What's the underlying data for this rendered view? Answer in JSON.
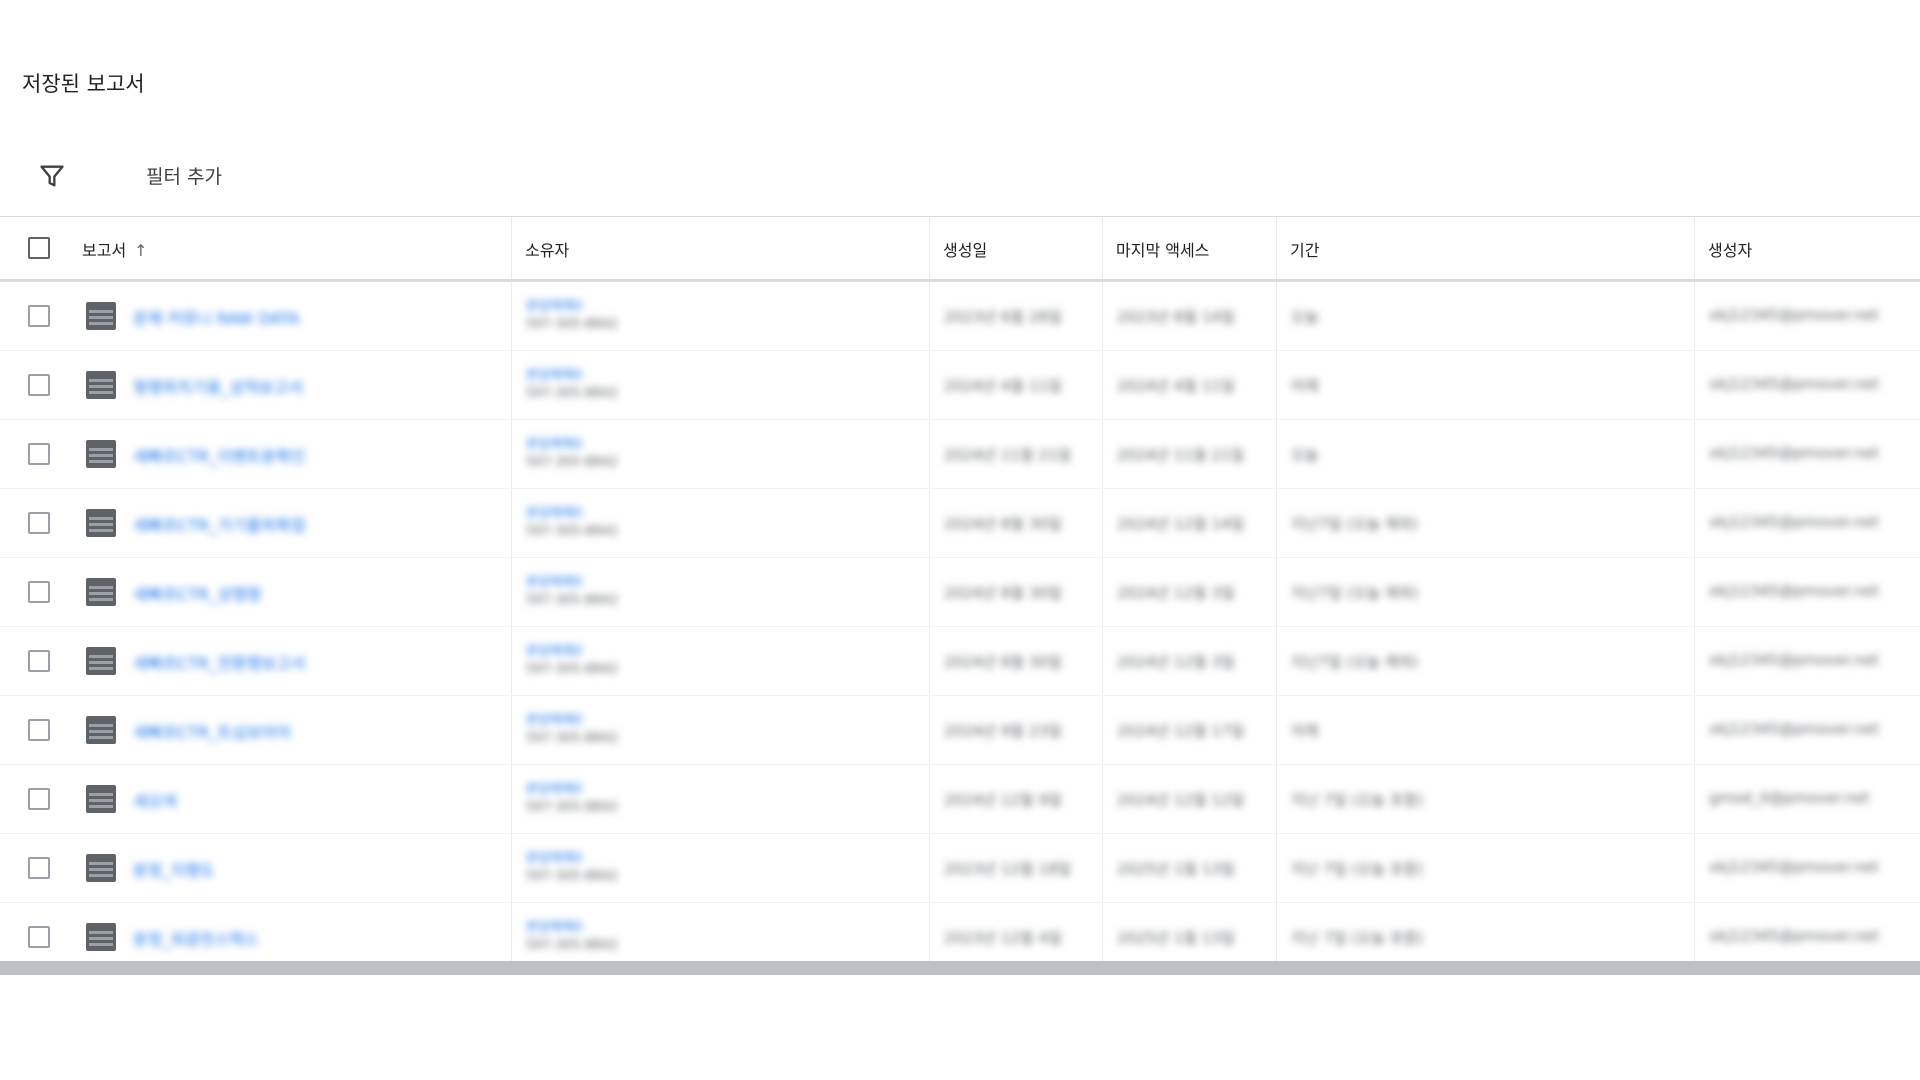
{
  "page": {
    "title": "저장된 보고서"
  },
  "filter": {
    "label": "필터 추가"
  },
  "table": {
    "columns": {
      "report": "보고서",
      "owner": "소유자",
      "created": "생성일",
      "last_access": "마지막 액세스",
      "period": "기간",
      "creator": "생성자"
    },
    "sort_indicator": "↑",
    "rows": [
      {
        "name": "문제 커뮤니 RAW DATA",
        "owner_name": "본담매체0",
        "owner_id": "597-305-8842",
        "created": "2023년 6월 28일",
        "last_access": "2023년 8월 14일",
        "period": "오늘",
        "creator": "xkj12345@pmover.net"
      },
      {
        "name": "형행위치기용_성적보고서",
        "owner_name": "본담매체0",
        "owner_id": "597-305-8842",
        "created": "2024년 4월 11일",
        "last_access": "2024년 4월 11일",
        "period": "어제",
        "creator": "xkj12345@pmover.net"
      },
      {
        "name": "세빠르CTR_이벤트분확인",
        "owner_name": "본담매체0",
        "owner_id": "597-305-8842",
        "created": "2024년 11월 21일",
        "last_access": "2024년 11월 21일",
        "period": "오늘",
        "creator": "xkj12345@pmover.net"
      },
      {
        "name": "세빠르CTR_가기물위확점",
        "owner_name": "본담매체0",
        "owner_id": "597-305-8842",
        "created": "2024년 8월 30일",
        "last_access": "2024년 12월 14일",
        "period": "지난7일 (오늘 제외)",
        "creator": "xkj12345@pmover.net"
      },
      {
        "name": "세빠르CTR_성행형",
        "owner_name": "본담매체0",
        "owner_id": "597-305-8842",
        "created": "2024년 8월 30일",
        "last_access": "2024년 12월 3일",
        "period": "지난7일 (오늘 제외)",
        "creator": "xkj12345@pmover.net"
      },
      {
        "name": "세빠르CTR_전환행보고서",
        "owner_name": "본담매체0",
        "owner_id": "597-305-8842",
        "created": "2024년 8월 30일",
        "last_access": "2024년 12월 3일",
        "period": "지난7일 (오늘 제외)",
        "creator": "xkj12345@pmover.net"
      },
      {
        "name": "세빠르CTR_트심보어어",
        "owner_name": "본담매체0",
        "owner_id": "597-305-8842",
        "created": "2024년 9월 23일",
        "last_access": "2024년 12월 17일",
        "period": "어제",
        "creator": "xkj12345@pmover.net"
      },
      {
        "name": "세오여",
        "owner_name": "본담매체0",
        "owner_id": "597-305-8842",
        "created": "2024년 12월 9일",
        "last_access": "2024년 12월 12일",
        "period": "지난 7일 (오늘 포함)",
        "creator": "gmod_0@pmover.net"
      },
      {
        "name": "분정_지행도",
        "owner_name": "본담매체0",
        "owner_id": "597-305-8842",
        "created": "2023년 12월 18일",
        "last_access": "2025년 1월 13일",
        "period": "지난 7일 (오늘 포함)",
        "creator": "xkj12345@pmover.net"
      },
      {
        "name": "분정_외광전스텍스",
        "owner_name": "본담매체0",
        "owner_id": "597-305-8842",
        "created": "2023년 12월 4일",
        "last_access": "2025년 1월 13일",
        "period": "지난 7일 (오늘 포함)",
        "creator": "xkj12345@pmover.net"
      }
    ]
  }
}
